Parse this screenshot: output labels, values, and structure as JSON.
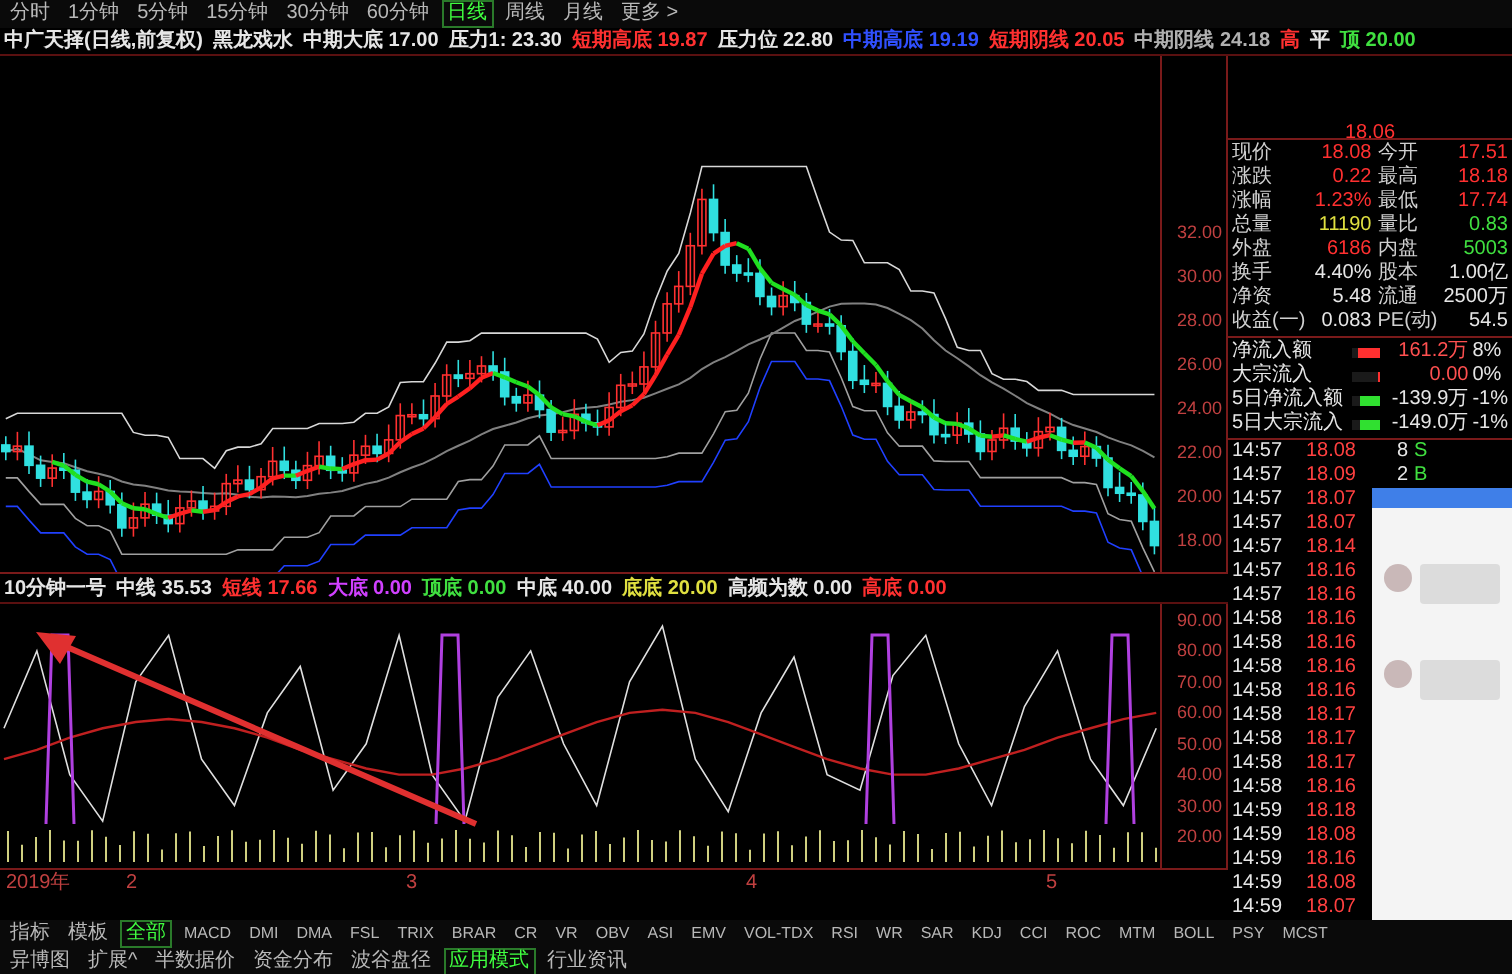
{
  "period_tabs": [
    {
      "label": "分时",
      "selected": false
    },
    {
      "label": "1分钟",
      "selected": false
    },
    {
      "label": "5分钟",
      "selected": false
    },
    {
      "label": "15分钟",
      "selected": false
    },
    {
      "label": "30分钟",
      "selected": false
    },
    {
      "label": "60分钟",
      "selected": false
    },
    {
      "label": "日线",
      "selected": true
    },
    {
      "label": "周线",
      "selected": false
    },
    {
      "label": "月线",
      "selected": false
    },
    {
      "label": "更多 >",
      "selected": false
    }
  ],
  "main_header": [
    {
      "text": "中广天择(日线,前复权)",
      "kind": "plain"
    },
    {
      "text": "黑龙戏水",
      "kind": "plain"
    },
    {
      "text": "中期大底 17.00",
      "kind": "plain"
    },
    {
      "text": "压力1: 23.30",
      "kind": "plain"
    },
    {
      "text": "短期高底 19.87",
      "kind": "short"
    },
    {
      "text": "压力位 22.80",
      "kind": "plain"
    },
    {
      "text": "中期高底 19.19",
      "kind": "mid"
    },
    {
      "text": "短期阴线 20.05",
      "kind": "short"
    },
    {
      "text": "中期阴线 24.18",
      "kind": "long"
    },
    {
      "text": "高",
      "kind": "short"
    },
    {
      "text": "平",
      "kind": "plain"
    },
    {
      "text": "顶 20.00",
      "kind": "signal"
    }
  ],
  "main_chart": {
    "price_axis": [
      "32.00",
      "30.00",
      "28.00",
      "26.00",
      "24.00",
      "22.00",
      "20.00",
      "18.00"
    ]
  },
  "sub_header": [
    {
      "text": "10分钟一号",
      "kind": "plain"
    },
    {
      "text": "中线 35.53",
      "kind": "plain"
    },
    {
      "text": "短线 17.66",
      "kind": "short"
    },
    {
      "text": "大底 0.00",
      "kind": "bottom"
    },
    {
      "text": "顶底 0.00",
      "kind": "signal"
    },
    {
      "text": "中底 40.00",
      "kind": "plain"
    },
    {
      "text": "底底 20.00",
      "kind": "floor"
    },
    {
      "text": "高频为数 0.00",
      "kind": "plain"
    },
    {
      "text": "高底 0.00",
      "kind": "short"
    }
  ],
  "sub_chart": {
    "chart_data": {
      "type": "line",
      "ylim": [
        10,
        95
      ],
      "yticks": [
        {
          "value": 90,
          "label": "90.00"
        },
        {
          "value": 80,
          "label": "80.00"
        },
        {
          "value": 70,
          "label": "70.00"
        },
        {
          "value": 60,
          "label": "60.00"
        },
        {
          "value": 50,
          "label": "50.00"
        },
        {
          "value": 40,
          "label": "40.00"
        },
        {
          "value": 30,
          "label": "30.00"
        },
        {
          "value": 20,
          "label": "20.00"
        }
      ],
      "series": [
        {
          "color": "#e0e0e0",
          "values": [
            55,
            80,
            40,
            25,
            70,
            85,
            45,
            30,
            60,
            75,
            35,
            50,
            85,
            40,
            25,
            65,
            80,
            50,
            30,
            70,
            88,
            45,
            28,
            60,
            78,
            40,
            35,
            72,
            85,
            50,
            30,
            62,
            80,
            45,
            30,
            55
          ]
        },
        {
          "color": "#c02020",
          "values": [
            45,
            48,
            52,
            55,
            57,
            58,
            57,
            55,
            52,
            48,
            45,
            42,
            40,
            40,
            42,
            45,
            49,
            53,
            57,
            60,
            61,
            60,
            57,
            53,
            49,
            45,
            42,
            40,
            40,
            42,
            45,
            48,
            52,
            55,
            58,
            60
          ]
        }
      ]
    }
  },
  "timeline": [
    "2019年",
    "2",
    "3",
    "4",
    "5"
  ],
  "quote": {
    "top_value": "18.06",
    "rows": [
      {
        "cells": [
          {
            "label": "现价",
            "value": "18.08",
            "color": "#ff3030"
          },
          {
            "label": "今开",
            "value": "17.51",
            "color": "#ff3030"
          }
        ]
      },
      {
        "cells": [
          {
            "label": "涨跌",
            "value": "0.22",
            "color": "#ff3030"
          },
          {
            "label": "最高",
            "value": "18.18",
            "color": "#ff3030"
          }
        ]
      },
      {
        "cells": [
          {
            "label": "涨幅",
            "value": "1.23%",
            "color": "#ff3030"
          },
          {
            "label": "最低",
            "value": "17.74",
            "color": "#ff3030"
          }
        ]
      },
      {
        "cells": [
          {
            "label": "总量",
            "value": "11190",
            "color": "#e0e040"
          },
          {
            "label": "量比",
            "value": "0.83",
            "color": "#40e040"
          }
        ]
      },
      {
        "cells": [
          {
            "label": "外盘",
            "value": "6186",
            "color": "#ff3030"
          },
          {
            "label": "内盘",
            "value": "5003",
            "color": "#40e040"
          }
        ]
      },
      {
        "cells": [
          {
            "label": "换手",
            "value": "4.40%",
            "color": "#e6e6e6"
          },
          {
            "label": "股本",
            "value": "1.00亿",
            "color": "#e6e6e6"
          }
        ]
      },
      {
        "cells": [
          {
            "label": "净资",
            "value": "5.48",
            "color": "#e6e6e6"
          },
          {
            "label": "流通",
            "value": "2500万",
            "color": "#e6e6e6"
          }
        ]
      },
      {
        "cells": [
          {
            "label": "收益(一)",
            "value": "0.083",
            "color": "#e6e6e6"
          },
          {
            "label": "PE(动)",
            "value": "54.5",
            "color": "#e6e6e6"
          }
        ]
      }
    ]
  },
  "fund_flow": [
    {
      "label": "净流入额",
      "color": "#ff3030",
      "level": 0.8,
      "value": "161.2万",
      "pct": "8%"
    },
    {
      "label": "大宗流入",
      "color": "#ff3030",
      "level": 0.1,
      "value": "0.00",
      "pct": "0%"
    },
    {
      "label": "5日净流入额",
      "color": "#30e030",
      "level": 0.7,
      "value": "-139.9万",
      "pct": "-1%"
    },
    {
      "label": "5日大宗流入",
      "color": "#30e030",
      "level": 0.7,
      "value": "-149.0万",
      "pct": "-1%"
    }
  ],
  "trades": [
    {
      "time": "14:57",
      "price": "18.08",
      "volume": "8",
      "side": "S"
    },
    {
      "time": "14:57",
      "price": "18.09",
      "volume": "2",
      "side": "B"
    },
    {
      "time": "14:57",
      "price": "18.07"
    },
    {
      "time": "14:57",
      "price": "18.07"
    },
    {
      "time": "14:57",
      "price": "18.14"
    },
    {
      "time": "14:57",
      "price": "18.16"
    },
    {
      "time": "14:57",
      "price": "18.16"
    },
    {
      "time": "14:58",
      "price": "18.16"
    },
    {
      "time": "14:58",
      "price": "18.16"
    },
    {
      "time": "14:58",
      "price": "18.16"
    },
    {
      "time": "14:58",
      "price": "18.16"
    },
    {
      "time": "14:58",
      "price": "18.17"
    },
    {
      "time": "14:58",
      "price": "18.17"
    },
    {
      "time": "14:58",
      "price": "18.17"
    },
    {
      "time": "14:58",
      "price": "18.16"
    },
    {
      "time": "14:59",
      "price": "18.18"
    },
    {
      "time": "14:59",
      "price": "18.08"
    },
    {
      "time": "14:59",
      "price": "18.16"
    },
    {
      "time": "14:59",
      "price": "18.08"
    },
    {
      "time": "14:59",
      "price": "18.07"
    }
  ],
  "indicator_tabs": [
    {
      "label": "指标",
      "selected": false
    },
    {
      "label": "模板",
      "selected": false
    },
    {
      "label": "全部",
      "selected": true
    },
    {
      "label": "MACD",
      "selected": false
    },
    {
      "label": "DMI",
      "selected": false
    },
    {
      "label": "DMA",
      "selected": false
    },
    {
      "label": "FSL",
      "selected": false
    },
    {
      "label": "TRIX",
      "selected": false
    },
    {
      "label": "BRAR",
      "selected": false
    },
    {
      "label": "CR",
      "selected": false
    },
    {
      "label": "VR",
      "selected": false
    },
    {
      "label": "OBV",
      "selected": false
    },
    {
      "label": "ASI",
      "selected": false
    },
    {
      "label": "EMV",
      "selected": false
    },
    {
      "label": "VOL-TDX",
      "selected": false
    },
    {
      "label": "RSI",
      "selected": false
    },
    {
      "label": "WR",
      "selected": false
    },
    {
      "label": "SAR",
      "selected": false
    },
    {
      "label": "KDJ",
      "selected": false
    },
    {
      "label": "CCI",
      "selected": false
    },
    {
      "label": "ROC",
      "selected": false
    },
    {
      "label": "MTM",
      "selected": false
    },
    {
      "label": "BOLL",
      "selected": false
    },
    {
      "label": "PSY",
      "selected": false
    },
    {
      "label": "MCST",
      "selected": false
    }
  ],
  "bottom_tabs": [
    {
      "label": "异博图",
      "selected": false
    },
    {
      "label": "扩展^",
      "selected": false
    },
    {
      "label": "半数据价",
      "selected": false
    },
    {
      "label": "资金分布",
      "selected": false
    },
    {
      "label": "波谷盘径",
      "selected": false
    },
    {
      "label": "应用模式",
      "selected": true
    },
    {
      "label": "行业资讯",
      "selected": false
    }
  ]
}
